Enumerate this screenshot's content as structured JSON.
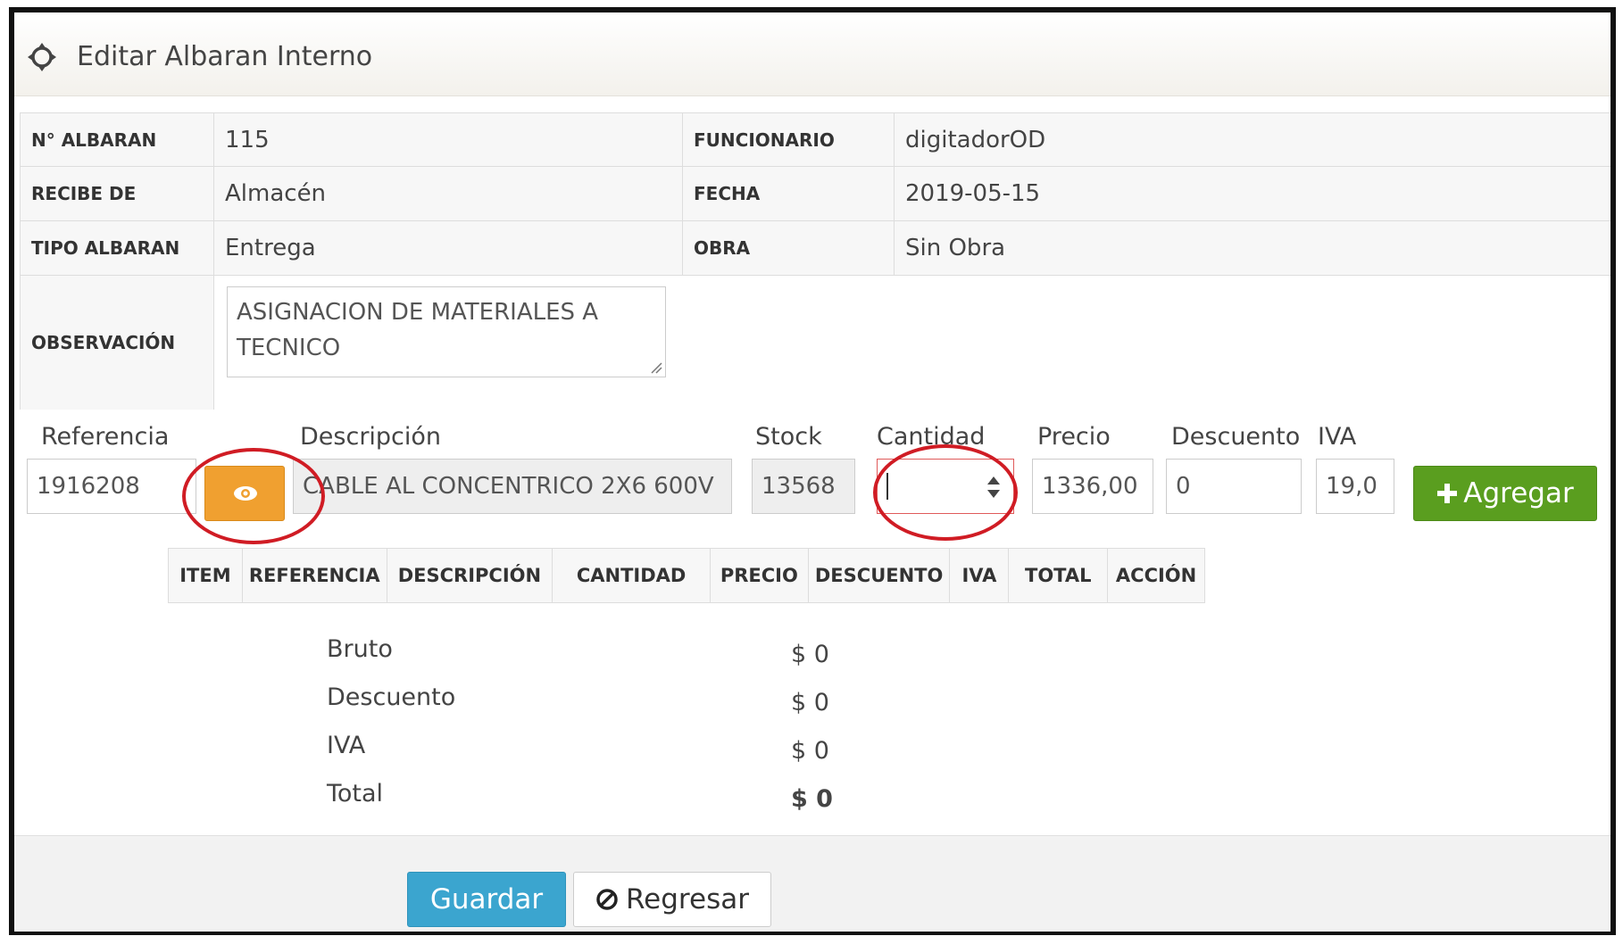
{
  "header": {
    "title": "Editar Albaran Interno",
    "icon": "crosshair-move-icon"
  },
  "info": {
    "albaran_label": "N° ALBARAN",
    "albaran_value": "115",
    "funcionario_label": "FUNCIONARIO",
    "funcionario_value": "digitadorOD",
    "recibe_label": "RECIBE DE",
    "recibe_value": "Almacén",
    "fecha_label": "FECHA",
    "fecha_value": "2019-05-15",
    "tipo_label": "TIPO ALBARAN",
    "tipo_value": "Entrega",
    "obra_label": "OBRA",
    "obra_value": "Sin Obra",
    "observacion_label": "OBSERVACIÓN",
    "observacion_value": "ASIGNACION DE MATERIALES A TECNICO"
  },
  "form": {
    "referencia_label": "Referencia",
    "referencia_value": "1916208",
    "descripcion_label": "Descripción",
    "descripcion_value": "CABLE AL CONCENTRICO 2X6 600V",
    "stock_label": "Stock",
    "stock_value": "13568",
    "cantidad_label": "Cantidad",
    "cantidad_value": "",
    "precio_label": "Precio",
    "precio_value": "1336,00",
    "descuento_label": "Descuento",
    "descuento_value": "0",
    "iva_label": "IVA",
    "iva_value": "19,0",
    "add_label": "Agregar"
  },
  "items_table": {
    "headers": [
      "ITEM",
      "REFERENCIA",
      "DESCRIPCIÓN",
      "CANTIDAD",
      "PRECIO",
      "DESCUENTO",
      "IVA",
      "TOTAL",
      "ACCIÓN"
    ]
  },
  "totals": {
    "bruto_label": "Bruto",
    "bruto_value": "$ 0",
    "descuento_label": "Descuento",
    "descuento_value": "$ 0",
    "iva_label": "IVA",
    "iva_value": "$ 0",
    "total_label": "Total",
    "total_value": "$ 0"
  },
  "footer": {
    "save_label": "Guardar",
    "back_label": "Regresar"
  },
  "colors": {
    "eye_button": "#f0a030",
    "add_button": "#5a9e1f",
    "save_button": "#3ba5cf",
    "highlight": "#d01c24"
  }
}
